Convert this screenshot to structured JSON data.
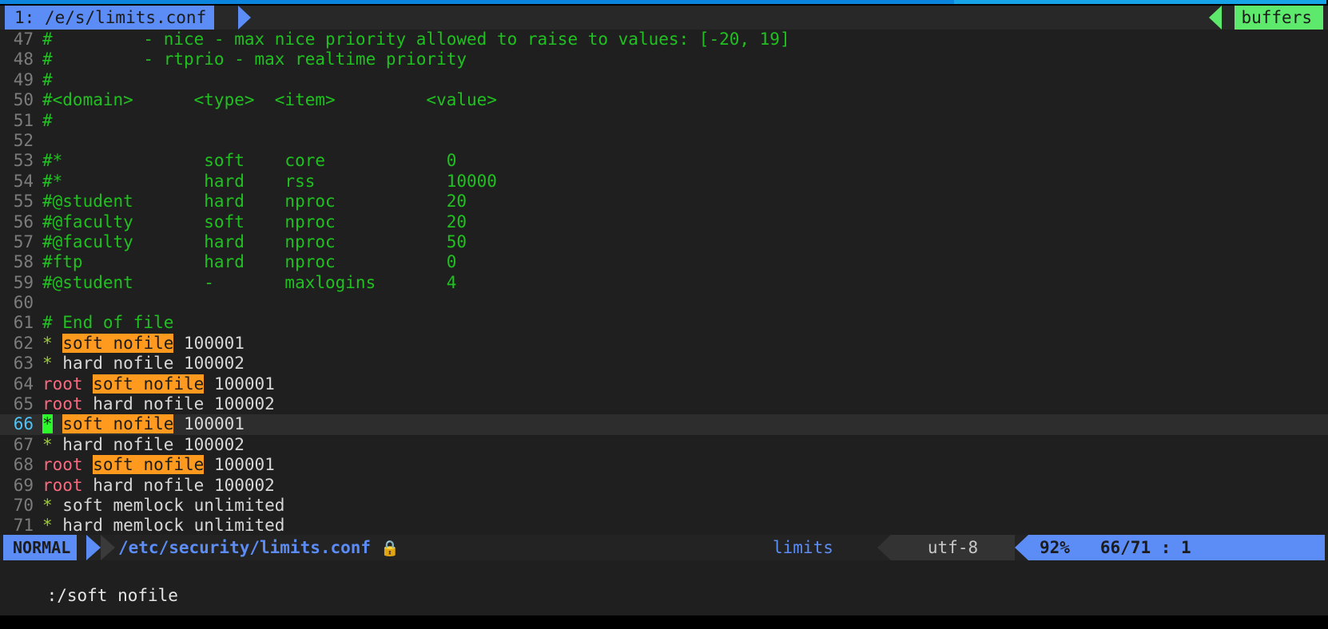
{
  "app": "neovim",
  "colors": {
    "background": "#1f1f1f",
    "tabline_bg": "#282828",
    "accent_blue": "#5c8cf5",
    "accent_green": "#5dea6c",
    "search_highlight": "#ff9a1f",
    "cursor": "#2cf82c",
    "comment": "#20c020",
    "root_token": "#f86a7e",
    "star_token": "#9acd32",
    "lock_icon": "#f0407a",
    "line_number": "#7c7c7c",
    "cursor_line_number": "#4fc3f7"
  },
  "tabline": {
    "active_tab": "1: /e/s/limits.conf",
    "buffers_label": "buffers"
  },
  "buffer": {
    "first_visible_line": 47,
    "lines": [
      {
        "num": 47,
        "segments": [
          {
            "text": "#         - nice - max nice priority allowed to raise to values: [-20, 19]",
            "cls": "cmt"
          }
        ]
      },
      {
        "num": 48,
        "segments": [
          {
            "text": "#         - rtprio - max realtime priority",
            "cls": "cmt"
          }
        ]
      },
      {
        "num": 49,
        "segments": [
          {
            "text": "#",
            "cls": "cmt"
          }
        ]
      },
      {
        "num": 50,
        "segments": [
          {
            "text": "#<domain>      <type>  <item>         <value>",
            "cls": "cmt"
          }
        ]
      },
      {
        "num": 51,
        "segments": [
          {
            "text": "#",
            "cls": "cmt"
          }
        ]
      },
      {
        "num": 52,
        "segments": [
          {
            "text": "",
            "cls": "plain"
          }
        ]
      },
      {
        "num": 53,
        "segments": [
          {
            "text": "#*              soft    core            0",
            "cls": "cmt"
          }
        ]
      },
      {
        "num": 54,
        "segments": [
          {
            "text": "#*              hard    rss             10000",
            "cls": "cmt"
          }
        ]
      },
      {
        "num": 55,
        "segments": [
          {
            "text": "#@student       hard    nproc           20",
            "cls": "cmt"
          }
        ]
      },
      {
        "num": 56,
        "segments": [
          {
            "text": "#@faculty       soft    nproc           20",
            "cls": "cmt"
          }
        ]
      },
      {
        "num": 57,
        "segments": [
          {
            "text": "#@faculty       hard    nproc           50",
            "cls": "cmt"
          }
        ]
      },
      {
        "num": 58,
        "segments": [
          {
            "text": "#ftp            hard    nproc           0",
            "cls": "cmt"
          }
        ]
      },
      {
        "num": 59,
        "segments": [
          {
            "text": "#@student       -       maxlogins       4",
            "cls": "cmt"
          }
        ]
      },
      {
        "num": 60,
        "segments": [
          {
            "text": "",
            "cls": "plain"
          }
        ]
      },
      {
        "num": 61,
        "segments": [
          {
            "text": "# End of file",
            "cls": "cmt"
          }
        ]
      },
      {
        "num": 62,
        "segments": [
          {
            "text": "*",
            "cls": "star"
          },
          {
            "text": " ",
            "cls": "plain"
          },
          {
            "text": "soft nofile",
            "cls": "hl"
          },
          {
            "text": " 100001",
            "cls": "plain"
          }
        ]
      },
      {
        "num": 63,
        "segments": [
          {
            "text": "*",
            "cls": "star"
          },
          {
            "text": " hard nofile 100002",
            "cls": "plain"
          }
        ]
      },
      {
        "num": 64,
        "segments": [
          {
            "text": "root",
            "cls": "root"
          },
          {
            "text": " ",
            "cls": "plain"
          },
          {
            "text": "soft nofile",
            "cls": "hl"
          },
          {
            "text": " 100001",
            "cls": "plain"
          }
        ]
      },
      {
        "num": 65,
        "segments": [
          {
            "text": "root",
            "cls": "root"
          },
          {
            "text": " hard nofile 100002",
            "cls": "plain"
          }
        ]
      },
      {
        "num": 66,
        "cursorline": true,
        "segments": [
          {
            "text": "*",
            "cls": "cursor-blk"
          },
          {
            "text": " ",
            "cls": "plain"
          },
          {
            "text": "soft nofile",
            "cls": "hl"
          },
          {
            "text": " 100001",
            "cls": "plain"
          }
        ]
      },
      {
        "num": 67,
        "segments": [
          {
            "text": "*",
            "cls": "star"
          },
          {
            "text": " hard nofile 100002",
            "cls": "plain"
          }
        ]
      },
      {
        "num": 68,
        "segments": [
          {
            "text": "root",
            "cls": "root"
          },
          {
            "text": " ",
            "cls": "plain"
          },
          {
            "text": "soft nofile",
            "cls": "hl"
          },
          {
            "text": " 100001",
            "cls": "plain"
          }
        ]
      },
      {
        "num": 69,
        "segments": [
          {
            "text": "root",
            "cls": "root"
          },
          {
            "text": " hard nofile 100002",
            "cls": "plain"
          }
        ]
      },
      {
        "num": 70,
        "segments": [
          {
            "text": "*",
            "cls": "star"
          },
          {
            "text": " soft memlock unlimited",
            "cls": "plain"
          }
        ]
      },
      {
        "num": 71,
        "segments": [
          {
            "text": "*",
            "cls": "star"
          },
          {
            "text": " hard memlock unlimited",
            "cls": "plain"
          }
        ]
      }
    ]
  },
  "statusline": {
    "mode": "NORMAL",
    "filename": "/etc/security/limits.conf",
    "lock_icon": "🔒",
    "filetype": "limits",
    "encoding": "utf-8",
    "percent": "92%",
    "position": "66/71 : 1"
  },
  "cmdline": {
    "text": ":/soft nofile"
  }
}
